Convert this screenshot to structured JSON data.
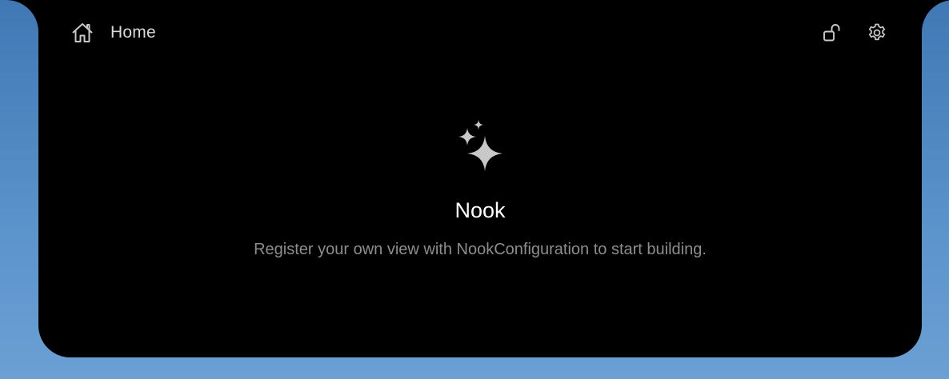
{
  "header": {
    "home_label": "Home",
    "home_icon": "house-icon",
    "lock_icon": "unlocked-padlock-icon",
    "settings_icon": "gear-icon"
  },
  "empty_state": {
    "icon": "sparkles-icon",
    "title": "Nook",
    "subtitle": "Register your own view with NookConfiguration to start building."
  },
  "colors": {
    "panel": "#000000",
    "desktop_top": "#3f78b4",
    "desktop_bottom": "#6aa0d4",
    "icon_gray": "#c8c8c8",
    "title_text": "#ffffff",
    "subtitle_text": "#8d8d8d"
  }
}
